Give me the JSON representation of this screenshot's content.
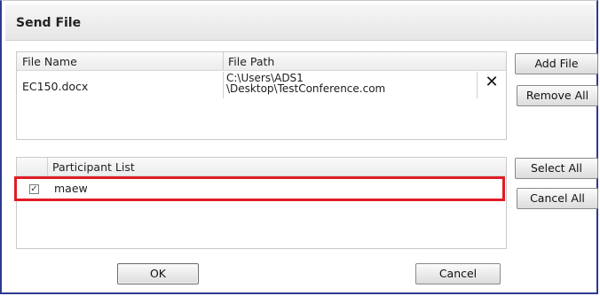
{
  "dialog": {
    "title": "Send File"
  },
  "files": {
    "headers": {
      "name": "File Name",
      "path": "File Path"
    },
    "rows": [
      {
        "name": "EC150.docx",
        "path_line1": "C:\\Users\\ADS1",
        "path_line2": "\\Desktop\\TestConference.com",
        "remove_icon": "✕"
      }
    ]
  },
  "participants": {
    "header": "Participant List",
    "rows": [
      {
        "checked": true,
        "check_glyph": "✓",
        "name": "maew"
      }
    ]
  },
  "buttons": {
    "add_file": "Add File",
    "remove_all": "Remove All",
    "select_all": "Select All",
    "cancel_all": "Cancel All",
    "ok": "OK",
    "cancel": "Cancel"
  },
  "colors": {
    "window_border": "#2d3a92",
    "highlight": "#e01d26"
  }
}
